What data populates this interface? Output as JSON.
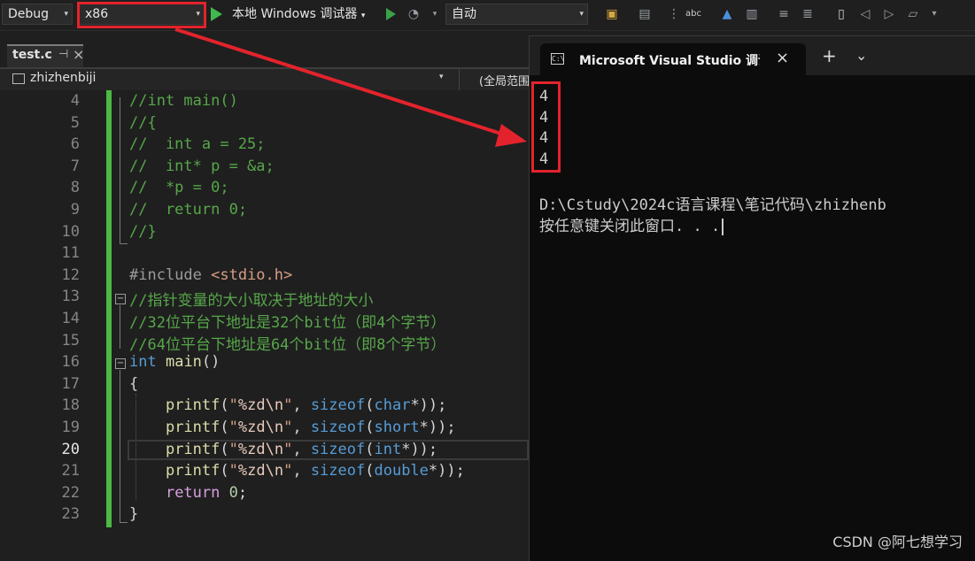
{
  "toolbar": {
    "config": "Debug",
    "platform": "x86",
    "run_label": "本地 Windows 调试器",
    "mode": "自动",
    "dropdown_arrow": "▾"
  },
  "editor": {
    "file_tab": "test.c",
    "pin": "⊣",
    "close": "×",
    "project": "zhizhenbiji",
    "scope": "(全局范围",
    "lines": [
      {
        "n": "4",
        "cls": "cmt",
        "text": "//int main()"
      },
      {
        "n": "5",
        "cls": "cmt",
        "text": "//{"
      },
      {
        "n": "6",
        "cls": "cmt",
        "text": "//  int a = 25;"
      },
      {
        "n": "7",
        "cls": "cmt",
        "text": "//  int* p = &a;"
      },
      {
        "n": "8",
        "cls": "cmt",
        "text": "//  *p = 0;"
      },
      {
        "n": "9",
        "cls": "cmt",
        "text": "//  return 0;"
      },
      {
        "n": "10",
        "cls": "cmt",
        "text": "//}"
      },
      {
        "n": "11",
        "cls": "",
        "text": ""
      },
      {
        "n": "12",
        "cls": "inc",
        "text": "#include <stdio.h>"
      },
      {
        "n": "13",
        "cls": "cmt",
        "text": "//指针变量的大小取决于地址的大小"
      },
      {
        "n": "14",
        "cls": "cmt",
        "text": "//32位平台下地址是32个bit位（即4个字节）"
      },
      {
        "n": "15",
        "cls": "cmt",
        "text": "//64位平台下地址是64个bit位（即8个字节）"
      },
      {
        "n": "16",
        "cls": "main",
        "text": "int main()"
      },
      {
        "n": "17",
        "cls": "",
        "text": "{"
      },
      {
        "n": "18",
        "cls": "printf",
        "text": "    printf(\"%zd\\n\", sizeof(char*));"
      },
      {
        "n": "19",
        "cls": "printf",
        "text": "    printf(\"%zd\\n\", sizeof(short*));"
      },
      {
        "n": "20",
        "cls": "printf",
        "text": "    printf(\"%zd\\n\", sizeof(int*));"
      },
      {
        "n": "21",
        "cls": "printf",
        "text": "    printf(\"%zd\\n\", sizeof(double*));"
      },
      {
        "n": "22",
        "cls": "ret",
        "text": "    return 0;"
      },
      {
        "n": "23",
        "cls": "",
        "text": "}"
      }
    ],
    "current_line": "20"
  },
  "console": {
    "title": "Microsoft Visual Studio 调试控",
    "close": "×",
    "new_tab": "+",
    "menu": "⌄",
    "output": [
      "4",
      "4",
      "4",
      "4"
    ],
    "path": "D:\\Cstudy\\2024c语言课程\\笔记代码\\zhizhenb",
    "prompt": "按任意键关闭此窗口. . ."
  },
  "watermark": "CSDN @阿七想学习",
  "colors": {
    "annotation_red": "#e3232c",
    "comment": "#57a64a",
    "keyword": "#569cd6",
    "change_bar": "#4cb944"
  }
}
